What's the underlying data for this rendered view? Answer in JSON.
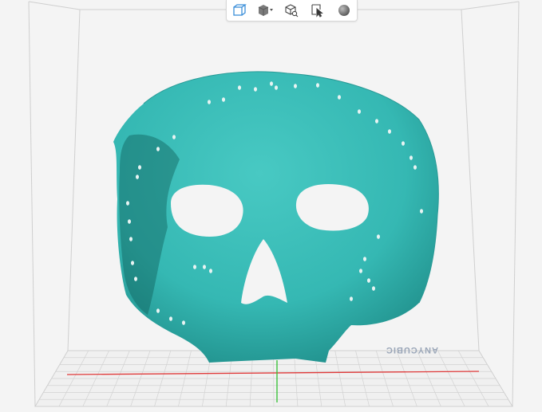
{
  "toolbar": {
    "items": [
      {
        "name": "view-cube-icon"
      },
      {
        "name": "view-preset-icon",
        "has_dropdown": true
      },
      {
        "name": "zoom-fit-icon"
      },
      {
        "name": "select-cursor-icon"
      },
      {
        "name": "render-mode-icon"
      }
    ]
  },
  "build_plate": {
    "brand_text": "ANYCUBIC"
  },
  "colors": {
    "model": "#35b8b3",
    "background": "#f4f4f4",
    "grid": "#c9c9c9",
    "x_axis": "#e03a3a",
    "y_axis": "#2fbf2f"
  }
}
